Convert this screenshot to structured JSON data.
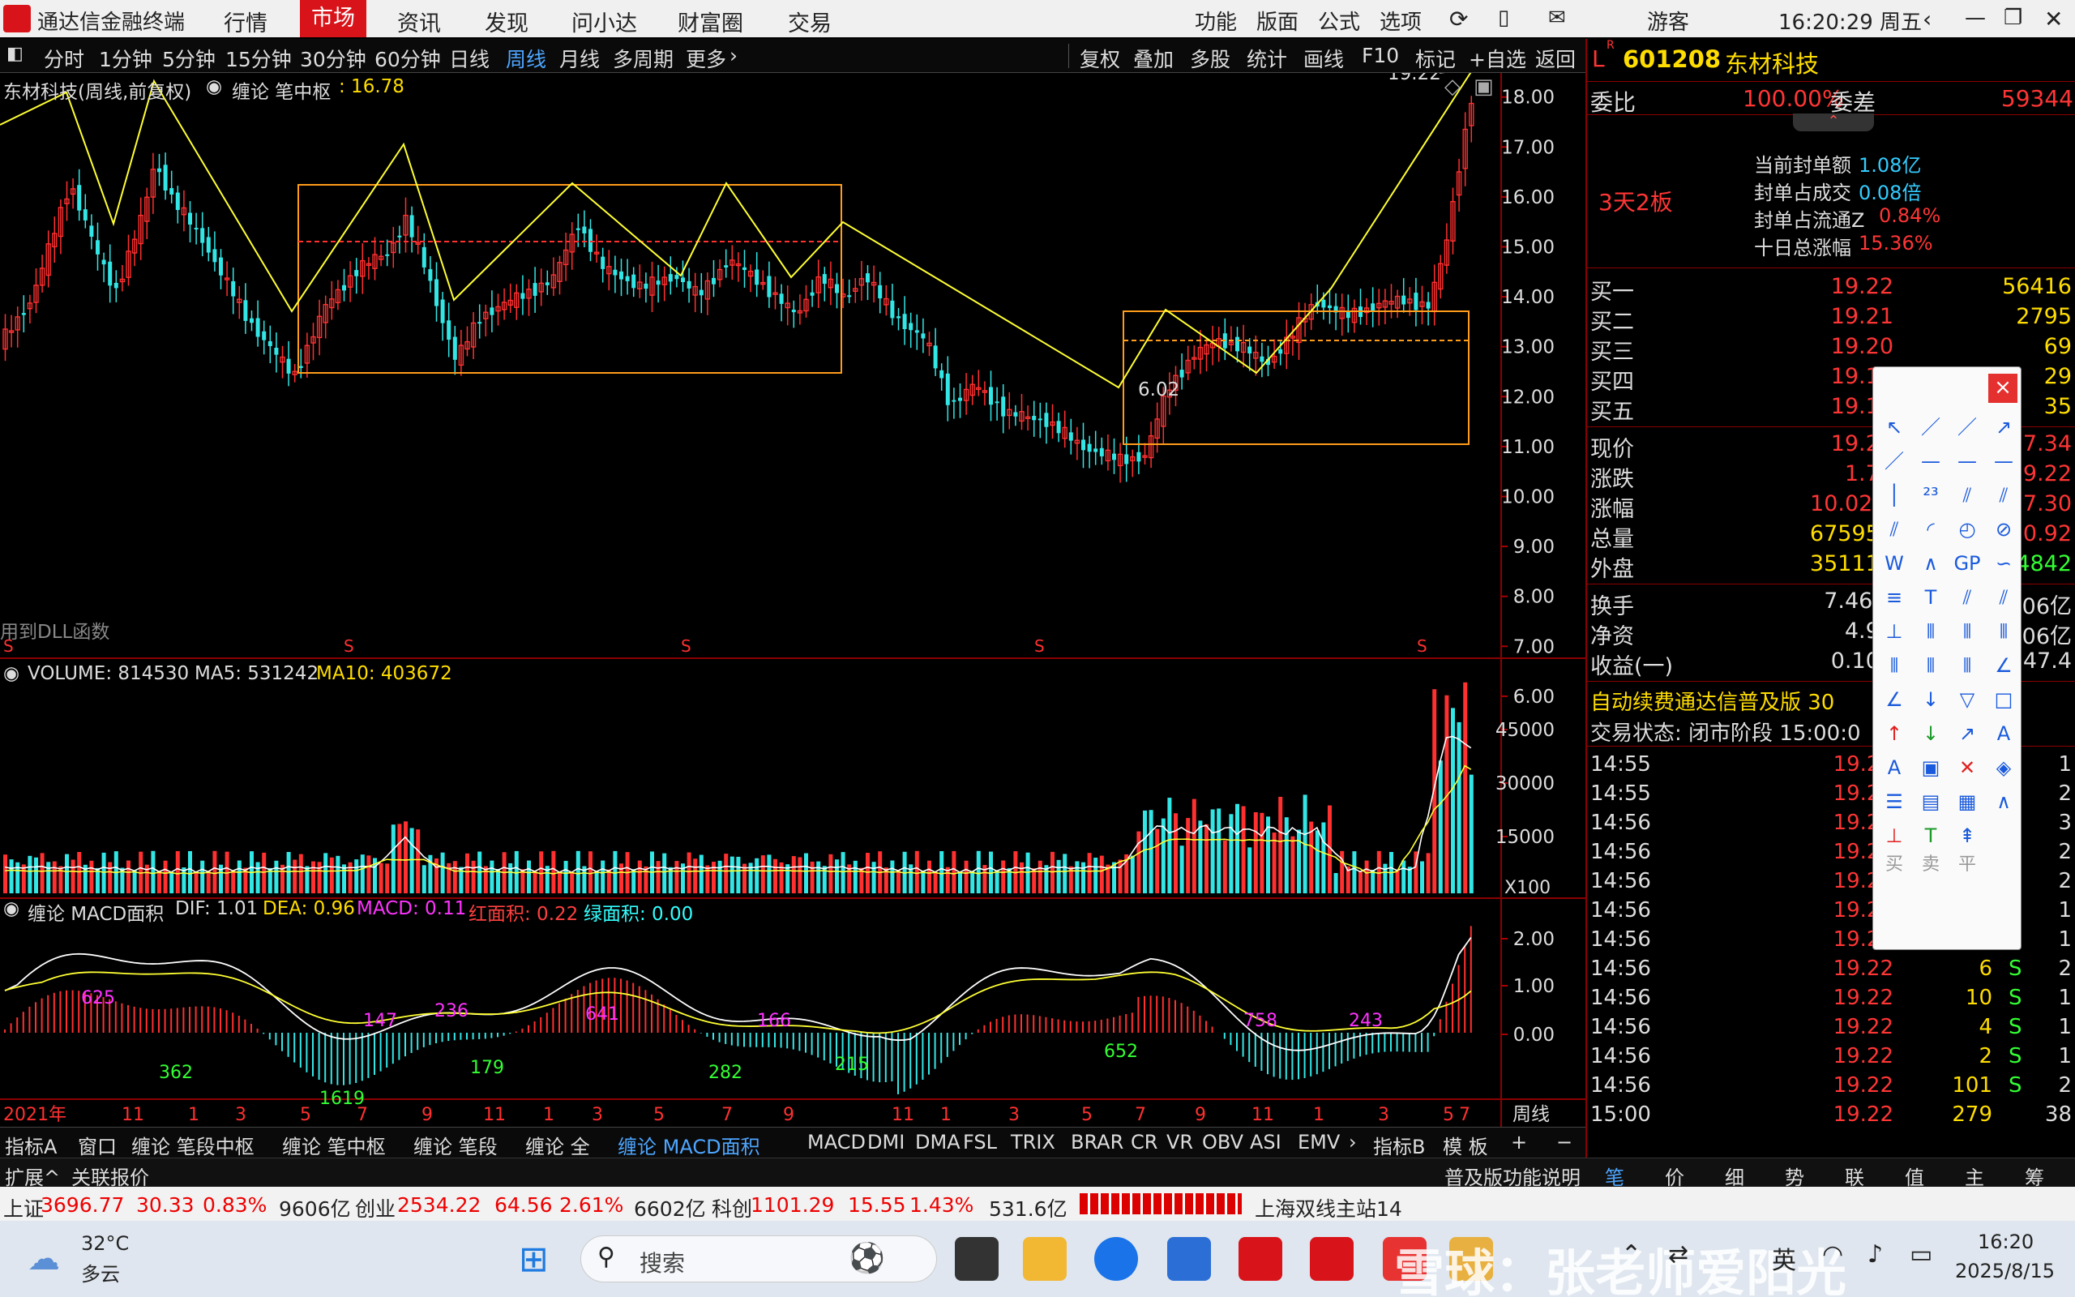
{
  "menubar": {
    "app_title": "通达信金融终端",
    "items": [
      "行情",
      "市场",
      "资讯",
      "发现",
      "问小达",
      "财富圈",
      "交易"
    ],
    "active": "市场",
    "right_items": [
      "功能",
      "版面",
      "公式",
      "选项"
    ],
    "user": "游客",
    "clock": "16:20:29 周五"
  },
  "toolbar": {
    "periods": [
      "分时",
      "1分钟",
      "5分钟",
      "15分钟",
      "30分钟",
      "60分钟",
      "日线",
      "周线",
      "月线",
      "多周期",
      "更多"
    ],
    "active_period": "周线",
    "right_buttons": [
      "复权",
      "叠加",
      "多股",
      "统计",
      "画线",
      "F10",
      "标记",
      "+自选",
      "返回"
    ]
  },
  "main_chart": {
    "title": "东材科技(周线,前复权)",
    "indicator_name": "缠论 笔中枢",
    "indicator_value": ": 16.78",
    "high_label": "19.22",
    "low_label": "6.02",
    "dll_note": "用到DLL函数",
    "y_ticks": [
      "18.00",
      "17.00",
      "16.00",
      "15.00",
      "14.00",
      "13.00",
      "12.00",
      "11.00",
      "10.00",
      "9.00",
      "8.00",
      "7.00",
      "6.00"
    ],
    "s_marker": "S"
  },
  "volume_pane": {
    "label": "VOLUME: 814530",
    "ma5": "MA5: 531242",
    "ma10": "MA10: 403672",
    "y_ticks": [
      "45000",
      "30000",
      "15000"
    ],
    "unit": "X100"
  },
  "macd_pane": {
    "name": "缠论 MACD面积",
    "dif": "DIF: 1.01",
    "dea": "DEA: 0.96",
    "macd": "MACD: 0.11",
    "red_area": "红面积: 0.22",
    "green_area": "绿面积: 0.00",
    "y_ticks": [
      "2.00",
      "1.00",
      "0.00"
    ],
    "area_labels": [
      {
        "t": "625",
        "c": "#ff33ff"
      },
      {
        "t": "362",
        "c": "#33ff33"
      },
      {
        "t": "1619",
        "c": "#33ff33"
      },
      {
        "t": "147",
        "c": "#ff33ff"
      },
      {
        "t": "236",
        "c": "#ff33ff"
      },
      {
        "t": "179",
        "c": "#33ff33"
      },
      {
        "t": "641",
        "c": "#ff33ff"
      },
      {
        "t": "282",
        "c": "#33ff33"
      },
      {
        "t": "166",
        "c": "#ff33ff"
      },
      {
        "t": "215",
        "c": "#33ff33"
      },
      {
        "t": "652",
        "c": "#33ff33"
      },
      {
        "t": "758",
        "c": "#ff33ff"
      },
      {
        "t": "243",
        "c": "#ff33ff"
      }
    ]
  },
  "time_axis": {
    "labels": [
      "2021年",
      "11",
      "1",
      "3",
      "5",
      "7",
      "9",
      "11",
      "1",
      "3",
      "5",
      "7",
      "9",
      "11",
      "1",
      "3",
      "5",
      "7",
      "9",
      "11",
      "1",
      "3",
      "5",
      "7"
    ],
    "period": "周线"
  },
  "indicator_tabs": [
    "指标A",
    "窗口",
    "缠论 笔段中枢",
    "缠论 笔中枢",
    "缠论 笔段",
    "缠论 全",
    "缠论 MACD面积",
    "MACD",
    "DMI",
    "DMA",
    "FSL",
    "TRIX",
    "BRAR",
    "CR",
    "VR",
    "OBV",
    "ASI",
    "EMV"
  ],
  "indicator_active": "缠论 MACD面积",
  "indicator_right": [
    "指标B",
    "模 板",
    "+",
    "−"
  ],
  "ext_bar": {
    "left": [
      "扩展^",
      "关联报价"
    ],
    "right_note": "普及版功能说明",
    "tabs": [
      "笔",
      "价",
      "细",
      "势",
      "联",
      "值",
      "主",
      "筹"
    ]
  },
  "right_panel": {
    "badge": "L",
    "code": "601208",
    "name": "东材科技",
    "weibi_label": "委比",
    "weibi_value": "100.00%",
    "weicha_label": "委差",
    "weicha_value": "59344",
    "board_tag": "3天2板",
    "seal_info": [
      {
        "k": "当前封单额",
        "v": "1.08亿"
      },
      {
        "k": "封单占成交",
        "v": "0.08倍"
      },
      {
        "k": "封单占流通Z",
        "v": "0.84%"
      },
      {
        "k": "十日总涨幅",
        "v": "15.36%"
      }
    ],
    "bids": [
      {
        "k": "买一",
        "p": "19.22",
        "v": "56416"
      },
      {
        "k": "买二",
        "p": "19.21",
        "v": "2795"
      },
      {
        "k": "买三",
        "p": "19.20",
        "v": "69"
      },
      {
        "k": "买四",
        "p": "19.19",
        "v": "29"
      },
      {
        "k": "买五",
        "p": "19.18",
        "v": "35"
      }
    ],
    "quote": [
      {
        "k": "现价",
        "v": "19.22",
        "k2": "今开",
        "v2": "17.34"
      },
      {
        "k": "涨跌",
        "v": "1.75",
        "k2": "最高",
        "v2": "19.22"
      },
      {
        "k": "涨幅",
        "v": "10.02%",
        "k2": "最低",
        "v2": "17.30"
      },
      {
        "k": "总量",
        "v": "675957",
        "k2": "量比",
        "v2": "0.92"
      },
      {
        "k": "外盘",
        "v": "351115",
        "k2": "内盘",
        "v2": "324842"
      }
    ],
    "fin": [
      {
        "k": "换手",
        "v": "7.46%",
        "k2": "股本",
        "v2": "10.06亿"
      },
      {
        "k": "净资",
        "v": "4.92",
        "k2": "流通",
        "v2": "10.06亿"
      },
      {
        "k": "收益(一)",
        "v": "0.100",
        "k2": "PE(动)",
        "v2": "47.4"
      }
    ],
    "promo": "自动续费通达信普及版 30",
    "trade_state": "交易状态: 闭市阶段 15:00:0",
    "ticks": [
      {
        "t": "14:55",
        "p": "19.22",
        "v": "",
        "s": "",
        "n": "1"
      },
      {
        "t": "14:55",
        "p": "19.22",
        "v": "",
        "s": "",
        "n": "2"
      },
      {
        "t": "14:56",
        "p": "19.22",
        "v": "",
        "s": "",
        "n": "3"
      },
      {
        "t": "14:56",
        "p": "19.22",
        "v": "",
        "s": "",
        "n": "2"
      },
      {
        "t": "14:56",
        "p": "19.22",
        "v": "",
        "s": "",
        "n": "2"
      },
      {
        "t": "14:56",
        "p": "19.22",
        "v": "",
        "s": "",
        "n": "1"
      },
      {
        "t": "14:56",
        "p": "19.22",
        "v": "",
        "s": "",
        "n": "1"
      },
      {
        "t": "14:56",
        "p": "19.22",
        "v": "6",
        "s": "S",
        "n": "2"
      },
      {
        "t": "14:56",
        "p": "19.22",
        "v": "10",
        "s": "S",
        "n": "1"
      },
      {
        "t": "14:56",
        "p": "19.22",
        "v": "4",
        "s": "S",
        "n": "1"
      },
      {
        "t": "14:56",
        "p": "19.22",
        "v": "2",
        "s": "S",
        "n": "1"
      },
      {
        "t": "14:56",
        "p": "19.22",
        "v": "101",
        "s": "S",
        "n": "2"
      },
      {
        "t": "15:00",
        "p": "19.22",
        "v": "279",
        "s": "",
        "n": "38"
      }
    ]
  },
  "drawbox": {
    "close": "×",
    "bottom_labels": [
      "买",
      "卖",
      "平"
    ]
  },
  "statusbar": {
    "sh_label": "上证",
    "sh_value": "3696.77",
    "sh_chg": "30.33",
    "sh_pct": "0.83%",
    "sh_amt": "9606亿",
    "cy_label": "创业",
    "cy_value": "2534.22",
    "cy_chg": "64.56",
    "cy_pct": "2.61%",
    "cy_amt": "6602亿",
    "kc_label": "科创",
    "kc_value": "1101.29",
    "kc_chg": "15.55",
    "kc_pct": "1.43%",
    "kc_amt": "531.6亿",
    "server": "上海双线主站14"
  },
  "taskbar": {
    "weather_temp": "32°C",
    "weather_desc": "多云",
    "search": "搜索",
    "ime": "英",
    "time": "16:20",
    "date": "2025/8/15",
    "watermark": "雪球：张老师爱阳光"
  }
}
